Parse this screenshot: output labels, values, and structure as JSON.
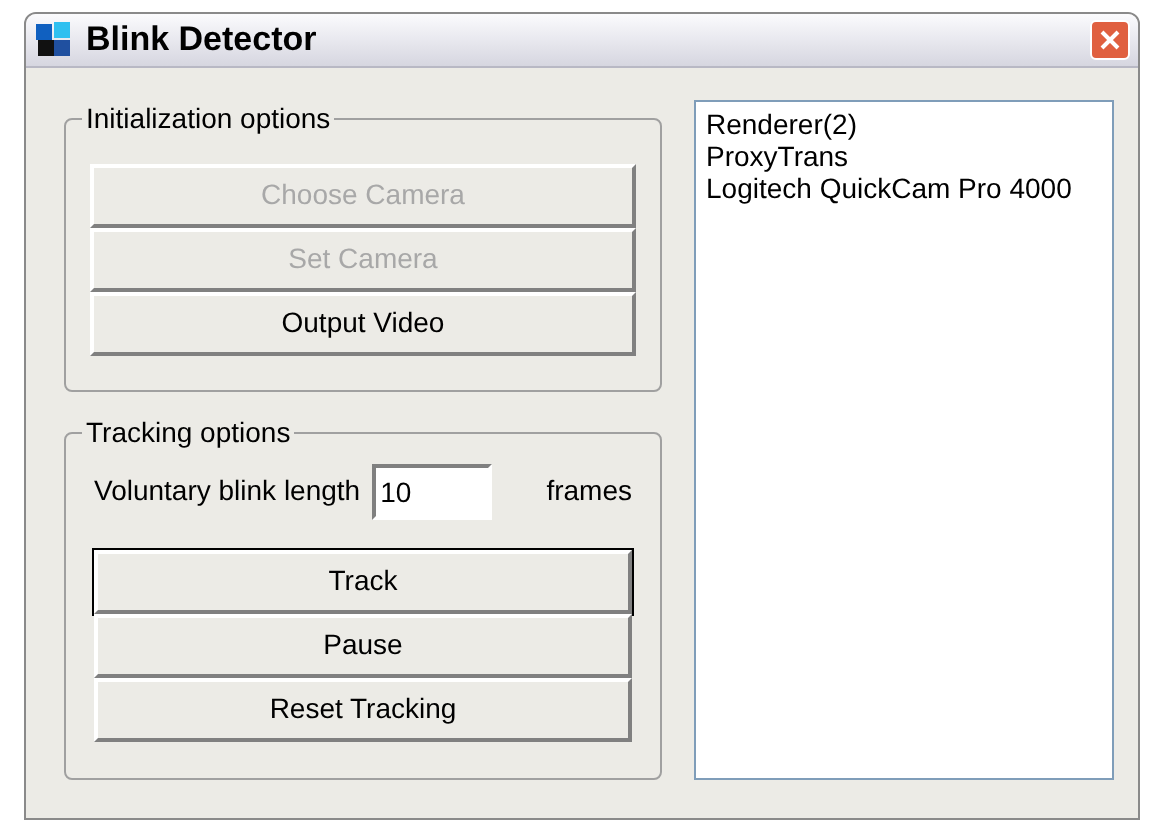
{
  "window": {
    "title": "Blink Detector"
  },
  "initialization": {
    "title": "Initialization options",
    "buttons": [
      {
        "label": "Choose Camera",
        "disabled": true,
        "default": false
      },
      {
        "label": "Set Camera",
        "disabled": true,
        "default": false
      },
      {
        "label": "Output Video",
        "disabled": false,
        "default": false
      }
    ]
  },
  "tracking": {
    "title": "Tracking options",
    "field_label": "Voluntary blink length",
    "field_value": "10",
    "unit": "frames",
    "buttons": [
      {
        "label": "Track",
        "disabled": false,
        "default": true
      },
      {
        "label": "Pause",
        "disabled": false,
        "default": false
      },
      {
        "label": "Reset Tracking",
        "disabled": false,
        "default": false
      }
    ]
  },
  "device_list": [
    "Renderer(2)",
    "ProxyTrans",
    "Logitech QuickCam Pro 4000"
  ]
}
